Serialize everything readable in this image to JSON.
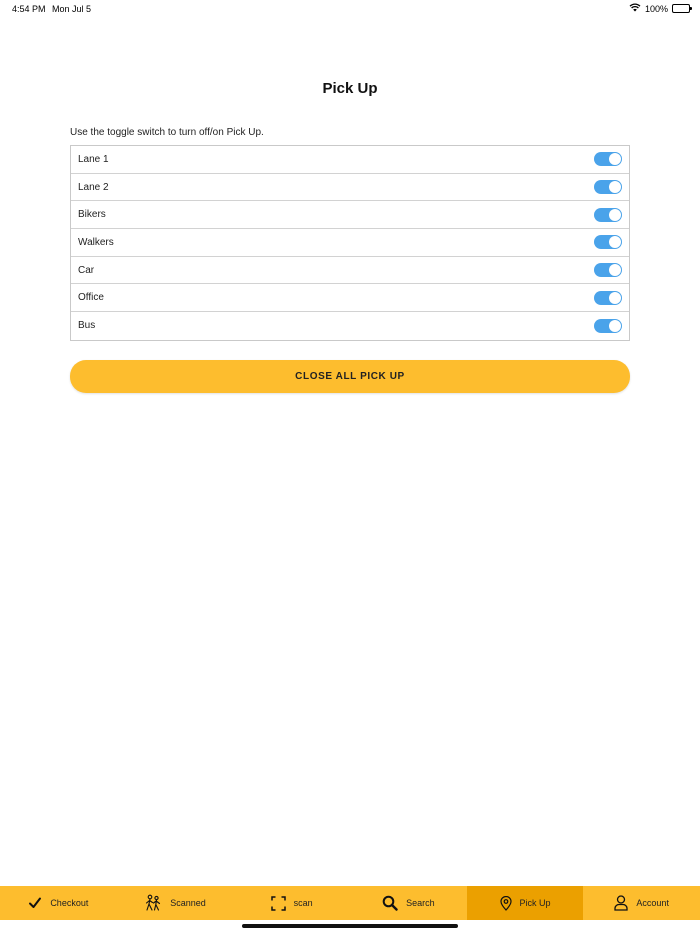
{
  "status": {
    "time": "4:54 PM",
    "date": "Mon Jul 5",
    "battery": "100%"
  },
  "header": {
    "title": "Pick Up"
  },
  "instruction": "Use the toggle switch to turn off/on Pick Up.",
  "toggles": [
    {
      "label": "Lane 1",
      "on": true
    },
    {
      "label": "Lane 2",
      "on": true
    },
    {
      "label": "Bikers",
      "on": true
    },
    {
      "label": "Walkers",
      "on": true
    },
    {
      "label": "Car",
      "on": true
    },
    {
      "label": "Office",
      "on": true
    },
    {
      "label": "Bus",
      "on": true
    }
  ],
  "close_all_label": "CLOSE ALL PICK UP",
  "tabs": [
    {
      "label": "Checkout",
      "icon": "checkmark-icon"
    },
    {
      "label": "Scanned",
      "icon": "walking-people-icon"
    },
    {
      "label": "scan",
      "icon": "scan-frame-icon"
    },
    {
      "label": "Search",
      "icon": "search-icon"
    },
    {
      "label": "Pick Up",
      "icon": "location-pin-icon",
      "active": true
    },
    {
      "label": "Account",
      "icon": "person-icon"
    }
  ],
  "colors": {
    "accent": "#fdbd2e",
    "active_tab": "#eba000",
    "toggle_on": "#4aa3ea"
  }
}
